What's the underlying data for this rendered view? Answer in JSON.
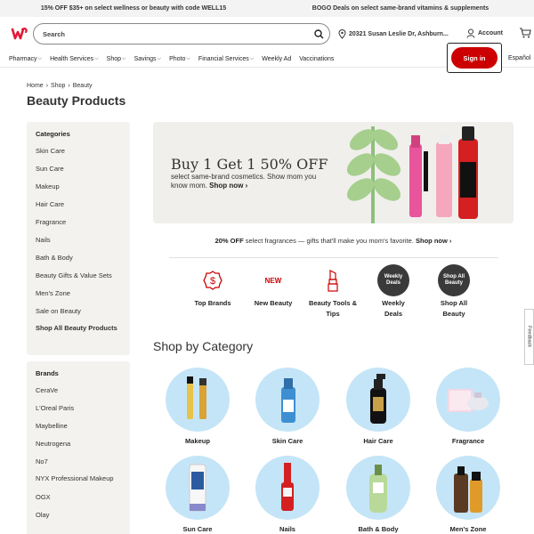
{
  "promos": {
    "left": "15% OFF $35+ on select wellness or beauty with code WELL15",
    "right": "BOGO Deals on select same-brand vitamins & supplements"
  },
  "header": {
    "search_placeholder": "Search",
    "location": "20321 Susan Leslie Dr, Ashburn...",
    "account": "Account",
    "sign_in": "Sign in",
    "espanol": "Español"
  },
  "nav": [
    {
      "label": "Pharmacy",
      "chevron": true
    },
    {
      "label": "Health Services",
      "chevron": true
    },
    {
      "label": "Shop",
      "chevron": true
    },
    {
      "label": "Savings",
      "chevron": true
    },
    {
      "label": "Photo",
      "chevron": true
    },
    {
      "label": "Financial Services",
      "chevron": true
    },
    {
      "label": "Weekly Ad",
      "chevron": false
    },
    {
      "label": "Vaccinations",
      "chevron": false
    }
  ],
  "breadcrumb": [
    "Home",
    "Shop",
    "Beauty"
  ],
  "page_title": "Beauty Products",
  "categories": {
    "heading": "Categories",
    "items": [
      "Skin Care",
      "Sun Care",
      "Makeup",
      "Hair Care",
      "Fragrance",
      "Nails",
      "Bath & Body",
      "Beauty Gifts & Value Sets",
      "Men's Zone",
      "Sale on Beauty"
    ],
    "all": "Shop All Beauty Products"
  },
  "brands": {
    "heading": "Brands",
    "items": [
      "CeraVe",
      "L'Oreal Paris",
      "Maybelline",
      "Neutrogena",
      "No7",
      "NYX Professional Makeup",
      "OGX",
      "Olay"
    ]
  },
  "hero": {
    "title": "Buy 1 Get 1 50% OFF",
    "subtitle": "select same-brand cosmetics. Show mom you know mom.",
    "cta": "Shop now ›"
  },
  "offer": {
    "bold": "20% OFF",
    "text": " select fragrances — gifts that'll make you mom's favorite. ",
    "cta": "Shop now ›"
  },
  "quick_links": [
    {
      "label": "Top Brands"
    },
    {
      "label": "New Beauty",
      "icon_text": "NEW"
    },
    {
      "label": "Beauty Tools & Tips"
    },
    {
      "label": "Weekly Deals",
      "icon_text": "Weekly Deals"
    },
    {
      "label": "Shop All Beauty",
      "icon_text": "Shop All Beauty"
    }
  ],
  "shop_by_category": {
    "title": "Shop by Category",
    "items": [
      "Makeup",
      "Skin Care",
      "Hair Care",
      "Fragrance",
      "Sun Care",
      "Nails",
      "Bath & Body",
      "Men's Zone"
    ]
  },
  "feedback": "Feedback",
  "colors": {
    "brand_red": "#cc0000",
    "category_circle": "#c4e5f7",
    "sidebar_bg": "#f3f2ef"
  }
}
